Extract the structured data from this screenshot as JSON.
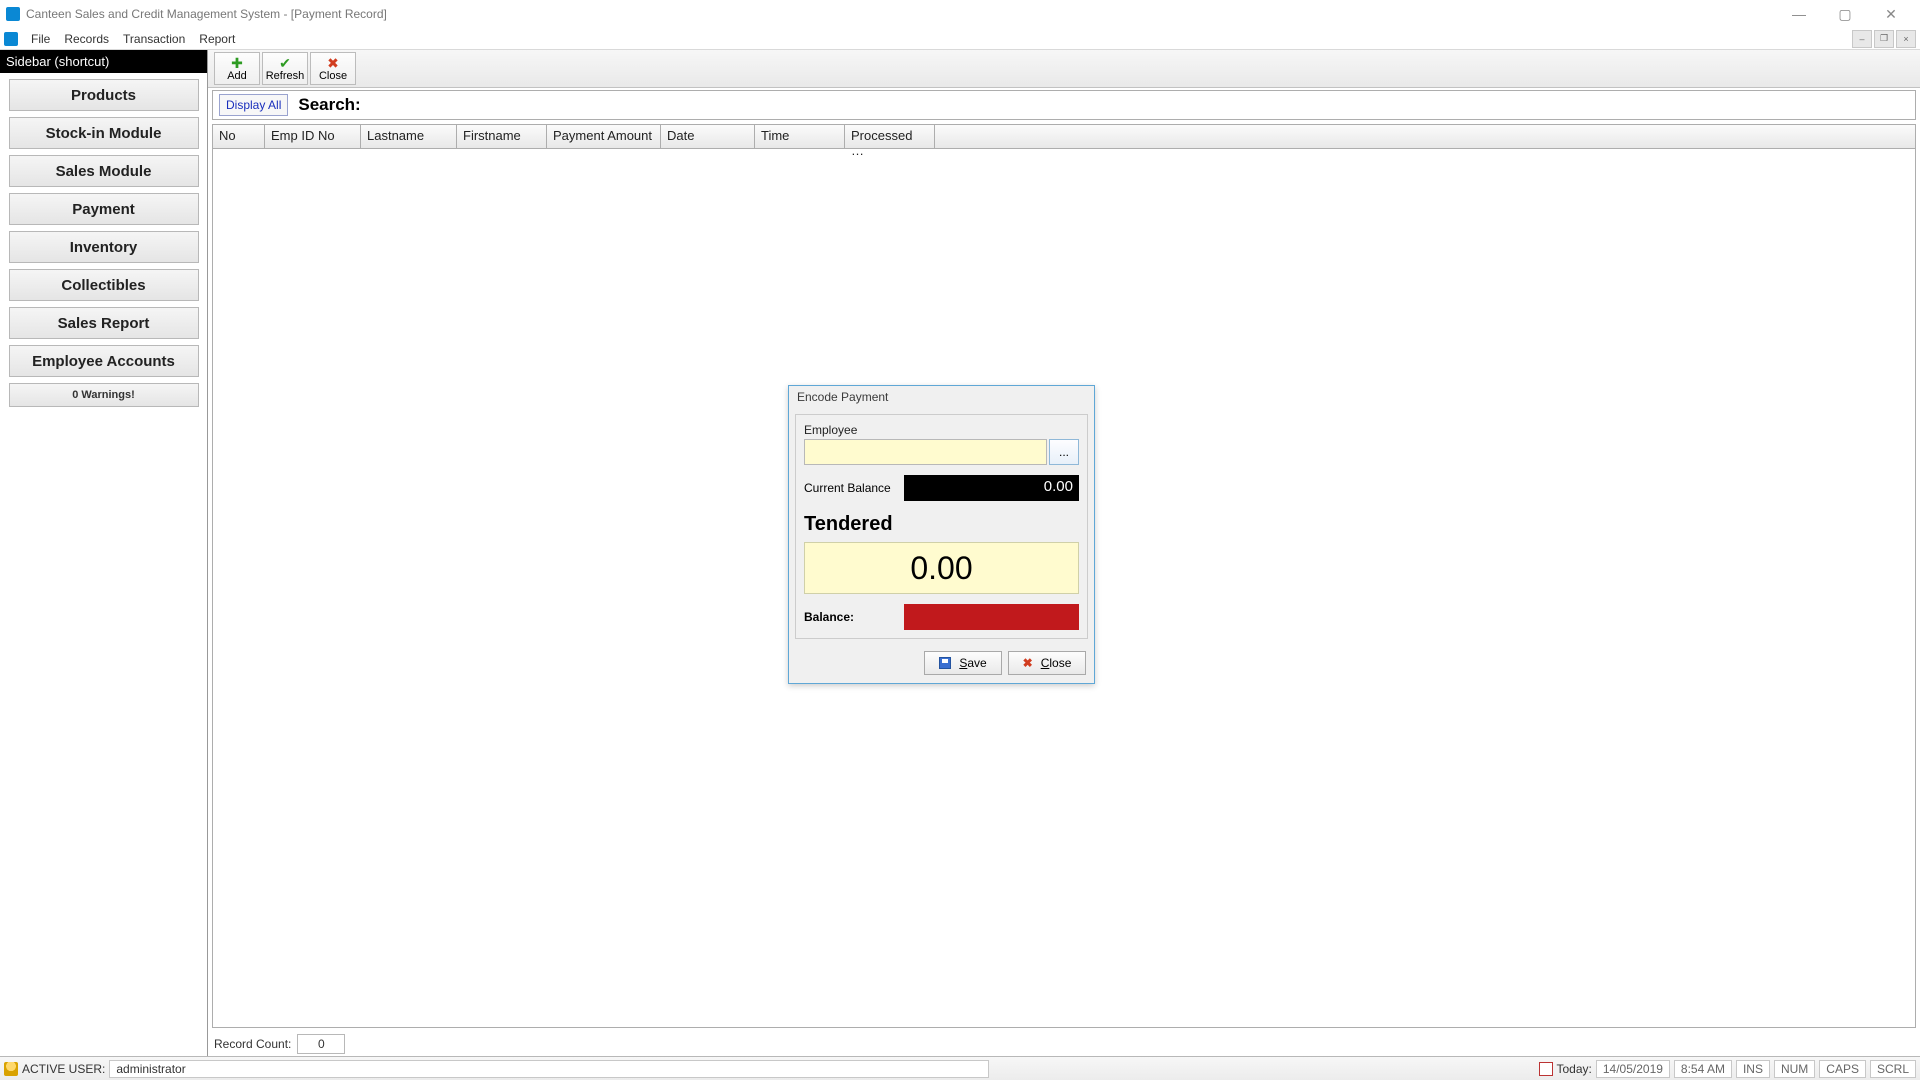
{
  "window": {
    "title": "Canteen Sales and Credit Management System - [Payment Record]"
  },
  "menu": {
    "file": "File",
    "records": "Records",
    "transaction": "Transaction",
    "report": "Report"
  },
  "sidebar": {
    "header": "Sidebar (shortcut)",
    "items": [
      "Products",
      "Stock-in Module",
      "Sales Module",
      "Payment",
      "Inventory",
      "Collectibles",
      "Sales Report",
      "Employee Accounts"
    ],
    "warnings": "0 Warnings!"
  },
  "toolbar": {
    "add": "Add",
    "refresh": "Refresh",
    "close": "Close"
  },
  "search": {
    "display_all": "Display All",
    "label": "Search:",
    "value": ""
  },
  "grid": {
    "columns": [
      "No",
      "Emp ID No",
      "Lastname",
      "Firstname",
      "Payment Amount",
      "Date",
      "Time",
      "Processed …"
    ],
    "record_count_label": "Record Count:",
    "record_count": "0"
  },
  "modal": {
    "title": "Encode Payment",
    "employee_label": "Employee",
    "employee_value": "",
    "lookup": "...",
    "current_balance_label": "Current Balance",
    "current_balance": "0.00",
    "tendered_label": "Tendered",
    "tendered_value": "0.00",
    "balance_label": "Balance:",
    "balance_value": "",
    "save": "Save",
    "close": "Close"
  },
  "status": {
    "active_user_label": "ACTIVE USER:",
    "active_user": "administrator",
    "today_label": "Today:",
    "date": "14/05/2019",
    "time": "8:54 AM",
    "ins": "INS",
    "num": "NUM",
    "caps": "CAPS",
    "scrl": "SCRL"
  }
}
